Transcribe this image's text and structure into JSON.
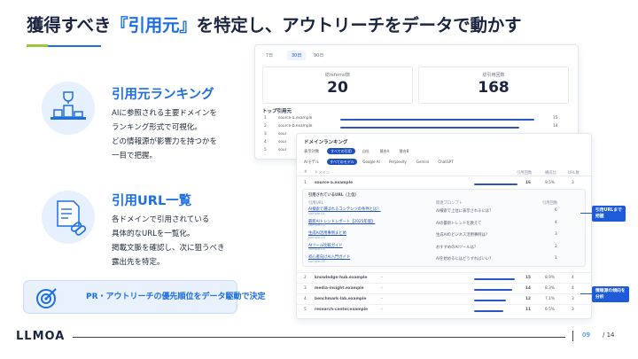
{
  "slide": {
    "title_pre": "獲得すべき",
    "title_hl": "『引用元』",
    "title_post": "を特定し、アウトリーチをデータで動かす"
  },
  "features": [
    {
      "title": "引用元ランキング",
      "lines": [
        "AIに参照される主要ドメインを",
        "ランキング形式で可視化。",
        "どの情報源が影響力を持つかを",
        "一目で把握。"
      ]
    },
    {
      "title": "引用URL一覧",
      "lines": [
        "各ドメインで引用されている",
        "具体的なURLを一覧化。",
        "掲載文脈を確認し、次に狙うべき",
        "露出先を特定。"
      ]
    }
  ],
  "banner": {
    "text": "PR・アウトリーチの優先順位をデータ駆動で決定"
  },
  "dashboard": {
    "tabs": [
      "7日",
      "30日",
      "90日"
    ],
    "stats": [
      {
        "label": "総referral数",
        "value": "20"
      },
      {
        "label": "総引用回数",
        "value": "168"
      }
    ],
    "top_section": "トップ引用元",
    "top_rows": [
      {
        "rank": "1",
        "name": "source-a.example",
        "value": "15",
        "frac": 0.95
      },
      {
        "rank": "2",
        "name": "source-b.example",
        "value": "14",
        "frac": 0.88
      },
      {
        "rank": "3",
        "name": "sour",
        "value": "",
        "frac": 0
      },
      {
        "rank": "4",
        "name": "sour",
        "value": "",
        "frac": 0
      },
      {
        "rank": "5",
        "name": "sour",
        "value": "",
        "frac": 0
      }
    ]
  },
  "ranking": {
    "title": "ドメインランキング",
    "filter_label1": "表示対象",
    "filter1": [
      "すべての引用",
      "自社",
      "競合A",
      "競合B"
    ],
    "filter_label2": "AIモデル",
    "filter2": [
      "すべてのモデル",
      "Google AI",
      "Perplexity",
      "Gemini",
      "ChatGPT"
    ],
    "headers": [
      "#",
      "ドメイン",
      "引用回数",
      "構成比",
      "URL数"
    ],
    "top_row": {
      "rank": "1",
      "domain": "source-a.example",
      "count": "16",
      "share": "9.5%",
      "urls": "3",
      "frac": 0.95
    },
    "url_section": {
      "title": "引用されているURL（上位）",
      "headers": [
        "引用URL",
        "関連プロンプト",
        "引用回数"
      ],
      "rows": [
        {
          "title": "AI検索で選ばれるコンテンツの条件とは？",
          "sub": "sample-01",
          "prompt": "AI検索で上位に表示されるには？",
          "count": "6"
        },
        {
          "title": "最新AIトレンドレポート【2025年版】",
          "sub": "sample-02",
          "prompt": "AIの最新トレンドを教えて",
          "count": "4"
        },
        {
          "title": "生成AI活用事例まとめ",
          "sub": "sample-03",
          "prompt": "生成AIのビジネス活用事例は？",
          "count": "3"
        },
        {
          "title": "AIツール比較ガイド",
          "sub": "sample-04",
          "prompt": "おすすめのAIツールは？",
          "count": "2"
        },
        {
          "title": "初心者向けAI入門ガイド",
          "sub": "sample-05",
          "prompt": "AIを始めるにはどうすればいい？",
          "count": "1"
        }
      ]
    },
    "rows": [
      {
        "rank": "2",
        "domain": "knowledge-hub.example",
        "count": "15",
        "share": "8.9%",
        "urls": "4",
        "frac": 0.88
      },
      {
        "rank": "3",
        "domain": "media-insight.example",
        "count": "14",
        "share": "8.3%",
        "urls": "4",
        "frac": 0.82
      },
      {
        "rank": "4",
        "domain": "benchmark-lab.example",
        "count": "12",
        "share": "7.1%",
        "urls": "3",
        "frac": 0.7
      },
      {
        "rank": "5",
        "domain": "research-center.example",
        "count": "11",
        "share": "6.5%",
        "urls": "3",
        "frac": 0.64
      }
    ]
  },
  "callouts": [
    {
      "lines": [
        "引用URLまで",
        "把握"
      ]
    },
    {
      "lines": [
        "情報源の傾向を",
        "分析"
      ]
    }
  ],
  "footer": {
    "logo": "LLMOA",
    "page": "09",
    "total": "/ 14"
  },
  "colors": {
    "accent": "#1e6fe0",
    "green": "#9cc836",
    "bar": "#2a56c6"
  }
}
